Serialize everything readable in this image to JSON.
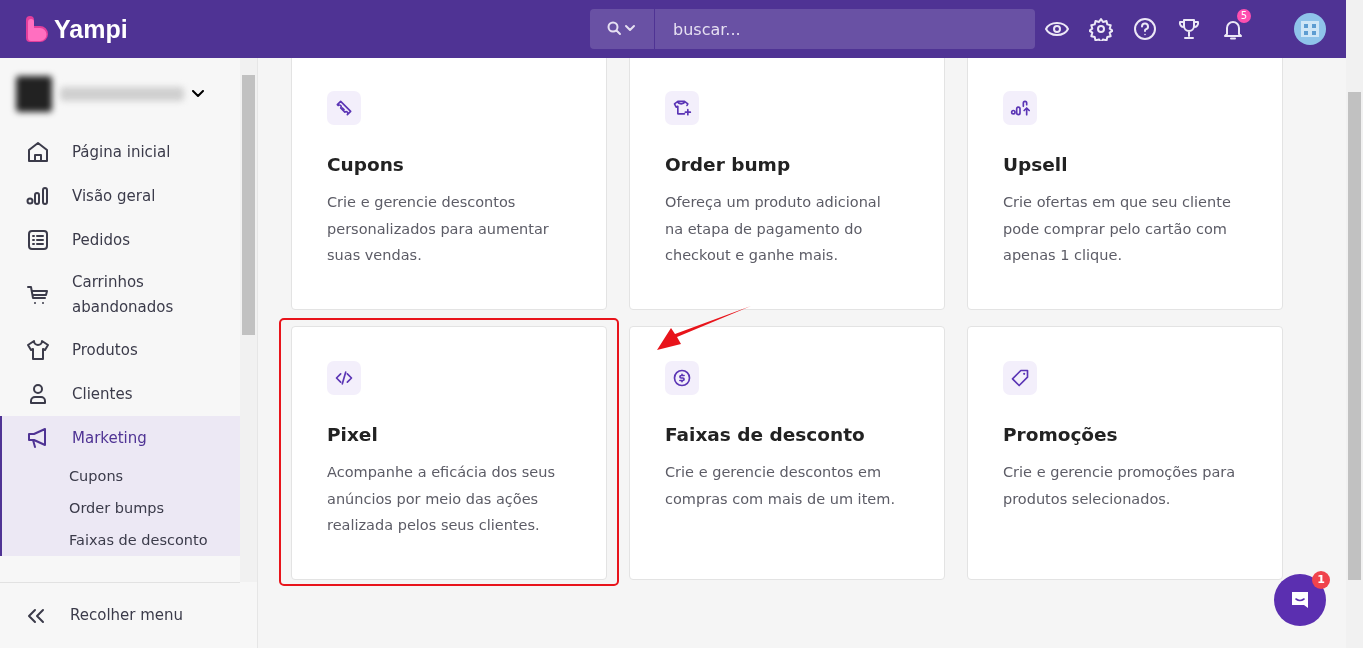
{
  "header": {
    "brand": "Yampi",
    "search": {
      "placeholder": "buscar..."
    },
    "notifications_badge": "5"
  },
  "sidebar": {
    "items": [
      {
        "label": "Página inicial",
        "selected": false
      },
      {
        "label": "Visão geral",
        "selected": false
      },
      {
        "label": "Pedidos",
        "selected": false
      },
      {
        "label": "Carrinhos abandonados",
        "selected": false
      },
      {
        "label": "Produtos",
        "selected": false
      },
      {
        "label": "Clientes",
        "selected": false
      },
      {
        "label": "Marketing",
        "selected": true,
        "expanded": true,
        "children": [
          {
            "label": "Cupons"
          },
          {
            "label": "Order bumps"
          },
          {
            "label": "Faixas de desconto"
          }
        ]
      }
    ],
    "collapse_label": "Recolher menu"
  },
  "cards": [
    {
      "title": "Cupons",
      "description": "Crie e gerencie descontos personalizados para aumentar suas vendas.",
      "highlighted": false
    },
    {
      "title": "Order bump",
      "description": "Ofereça um produto adicional na etapa de pagamento do checkout e ganhe mais.",
      "highlighted": false
    },
    {
      "title": "Upsell",
      "description": "Crie ofertas em que seu cliente pode comprar pelo cartão com apenas 1 clique.",
      "highlighted": false
    },
    {
      "title": "Pixel",
      "description": "Acompanhe a eficácia dos seus anúncios por meio das ações realizada pelos seus clientes.",
      "highlighted": true
    },
    {
      "title": "Faixas de desconto",
      "description": "Crie e gerencie descontos em compras com mais de um item.",
      "highlighted": false
    },
    {
      "title": "Promoções",
      "description": "Crie e gerencie promoções para produtos selecionados.",
      "highlighted": false
    }
  ],
  "annotation_arrow": true,
  "chat": {
    "badge": "1"
  }
}
